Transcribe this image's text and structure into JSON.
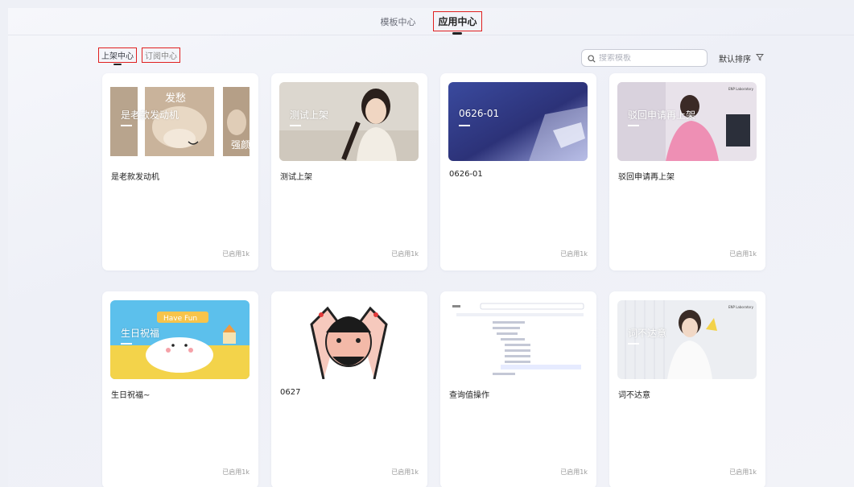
{
  "top_tabs": [
    {
      "label": "模板中心",
      "active": false
    },
    {
      "label": "应用中心",
      "active": true
    }
  ],
  "sub_tabs": [
    {
      "label": "上架中心",
      "active": true
    },
    {
      "label": "订阅中心",
      "active": false
    }
  ],
  "search": {
    "placeholder": "搜索模板",
    "icon": "search-icon"
  },
  "sort": {
    "label": "默认排序",
    "icon": "filter-icon"
  },
  "cards": [
    {
      "name": "是老款发动机",
      "overlay_title": "是老款发动机",
      "image": "hamster-meme",
      "usage": "已启用1k"
    },
    {
      "name": "测试上架",
      "overlay_title": "测试上架",
      "image": "girl-portrait",
      "usage": "已启用1k"
    },
    {
      "name": "0626-01",
      "overlay_title": "0626-01",
      "image": "blue-office",
      "usage": "已启用1k"
    },
    {
      "name": "驳回申请再上架",
      "overlay_title": "驳回申请再上架",
      "image": "pink-outfit-woman",
      "usage": "已启用1k"
    },
    {
      "name": "生日祝福~",
      "overlay_title": "生日祝福",
      "image": "birthday-cake",
      "usage": "已启用1k"
    },
    {
      "name": "0627",
      "overlay_title": "",
      "image": "cartoon-meme",
      "usage": "已启用1k"
    },
    {
      "name": "查询值操作",
      "overlay_title": "",
      "image": "tree-ui-screenshot",
      "usage": "已启用1k"
    },
    {
      "name": "词不达意",
      "overlay_title": "词不达意",
      "image": "white-dress-woman",
      "usage": "已启用1k"
    }
  ],
  "thumb_text": {
    "hamster_1": "发愁",
    "hamster_2": "强颜",
    "lab_brand": "ENP Laboratory",
    "have_fun": "Have Fun"
  },
  "colors": {
    "accent_red": "#e02020",
    "background": "#eef0f6",
    "card": "#ffffff"
  }
}
